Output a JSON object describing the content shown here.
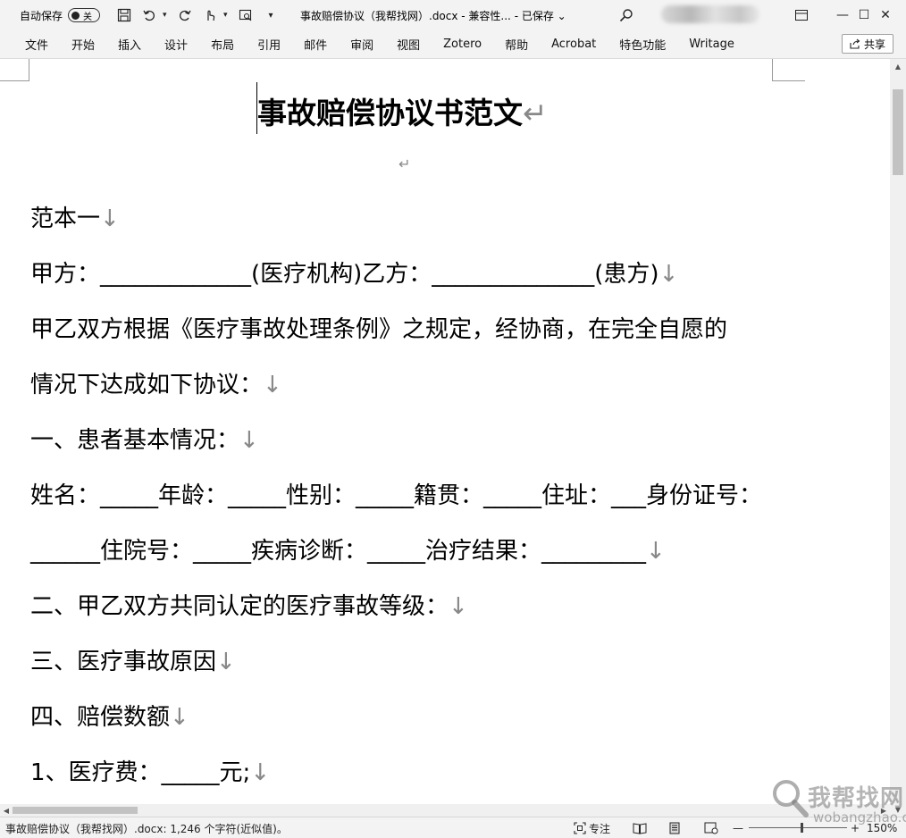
{
  "titlebar": {
    "autosave_label": "自动保存",
    "autosave_state": "关",
    "doc_title": "事故赔偿协议（我帮找网）.docx  -  兼容性...  -  已保存 ⌄",
    "minimize": "—",
    "maximize": "☐",
    "close": "✕"
  },
  "ribbon": {
    "tabs": [
      "文件",
      "开始",
      "插入",
      "设计",
      "布局",
      "引用",
      "邮件",
      "审阅",
      "视图",
      "Zotero",
      "帮助",
      "Acrobat",
      "特色功能",
      "Writage"
    ],
    "share_label": "共享"
  },
  "document": {
    "title": "事故赔偿协议书范文",
    "paragraph_mark": "↵",
    "line_mark": "↓",
    "paragraphs": [
      "范本一",
      "甲方：_____________(医疗机构)乙方：______________(患方)",
      "甲乙双方根据《医疗事故处理条例》之规定，经协商，在完全自愿的",
      "情况下达成如下协议：",
      "一、患者基本情况：",
      "姓名：_____年龄：_____性别：_____籍贯：_____住址：___身份证号：",
      "______住院号：_____疾病诊断：_____治疗结果：_________",
      "二、甲乙双方共同认定的医疗事故等级：",
      "三、医疗事故原因",
      "四、赔偿数额",
      "1、医疗费：_____元;"
    ]
  },
  "statusbar": {
    "doc_info": "事故赔偿协议（我帮找网）.docx: 1,246 个字符(近似值)。",
    "focus_label": "专注",
    "zoom_minus": "—",
    "zoom_plus": "+",
    "zoom_value": "150%"
  },
  "watermark": {
    "logo_text": "我帮找网",
    "url": "wobangzhao.com"
  }
}
